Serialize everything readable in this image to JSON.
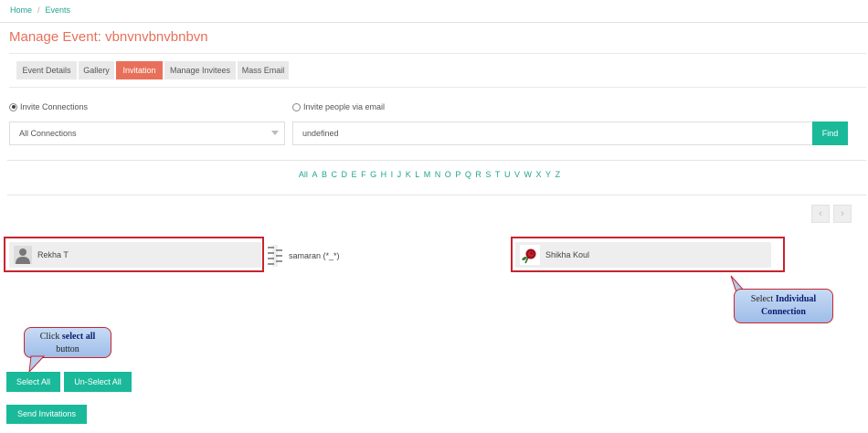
{
  "breadcrumb": {
    "home": "Home",
    "separator": "/",
    "current": "Events"
  },
  "page_title": "Manage Event: vbnvnvbnvbnbvn",
  "tabs": [
    {
      "label": "Event Details",
      "active": false
    },
    {
      "label": "Gallery",
      "active": false
    },
    {
      "label": "Invitation",
      "active": true
    },
    {
      "label": "Manage Invitees",
      "active": false
    },
    {
      "label": "Mass Email",
      "active": false
    }
  ],
  "invite": {
    "option_connections": "Invite Connections",
    "option_email": "Invite people via email",
    "connections_select": "All Connections",
    "email_input_value": "undefined",
    "find_label": "Find"
  },
  "alphabet": [
    "All",
    "A",
    "B",
    "C",
    "D",
    "E",
    "F",
    "G",
    "H",
    "I",
    "J",
    "K",
    "L",
    "M",
    "N",
    "O",
    "P",
    "Q",
    "R",
    "S",
    "T",
    "U",
    "V",
    "W",
    "X",
    "Y",
    "Z"
  ],
  "pager": {
    "prev": "‹",
    "next": "›"
  },
  "connections": [
    {
      "name": "Rekha T",
      "icon": "user-avatar-icon"
    },
    {
      "name": "samaran (*_*)",
      "icon": "zipper-avatar-icon"
    },
    {
      "name": "Shikha Koul",
      "icon": "rose-avatar-icon"
    }
  ],
  "callouts": {
    "select_all_prefix": "Click ",
    "select_all_bold": "select all",
    "select_all_suffix": "button",
    "individual_prefix": "Select ",
    "individual_bold_1": "Individual",
    "individual_bold_2": "Connection"
  },
  "buttons": {
    "select_all": "Select All",
    "unselect_all": "Un-Select All",
    "send": "Send Invitations"
  },
  "colors": {
    "accent": "#e8705a",
    "primary": "#1ab99a",
    "link": "#1fa58f",
    "highlight_border": "#c8242e"
  }
}
